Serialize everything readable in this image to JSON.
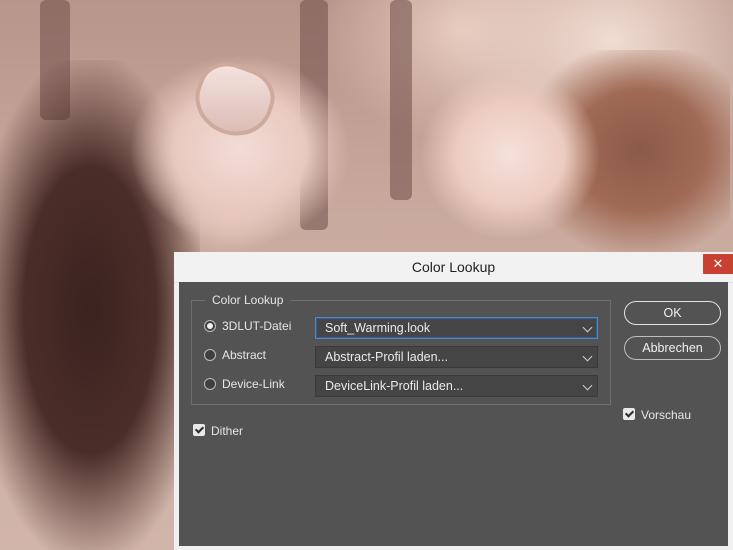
{
  "dialog": {
    "title": "Color Lookup",
    "close_label": "✕",
    "group_label": "Color Lookup",
    "rows": [
      {
        "label": "3DLUT-Datei",
        "selected": true,
        "value": "Soft_Warming.look"
      },
      {
        "label": "Abstract",
        "selected": false,
        "value": "Abstract-Profil laden..."
      },
      {
        "label": "Device-Link",
        "selected": false,
        "value": "DeviceLink-Profil laden..."
      }
    ],
    "dither": {
      "label": "Dither",
      "checked": true
    },
    "buttons": {
      "ok": "OK",
      "cancel": "Abbrechen"
    },
    "preview": {
      "label": "Vorschau",
      "checked": true
    }
  },
  "colors": {
    "dialog_body": "#535353",
    "titlebar": "#f2f2f2",
    "close": "#c84031",
    "focus": "#4f86c6"
  }
}
